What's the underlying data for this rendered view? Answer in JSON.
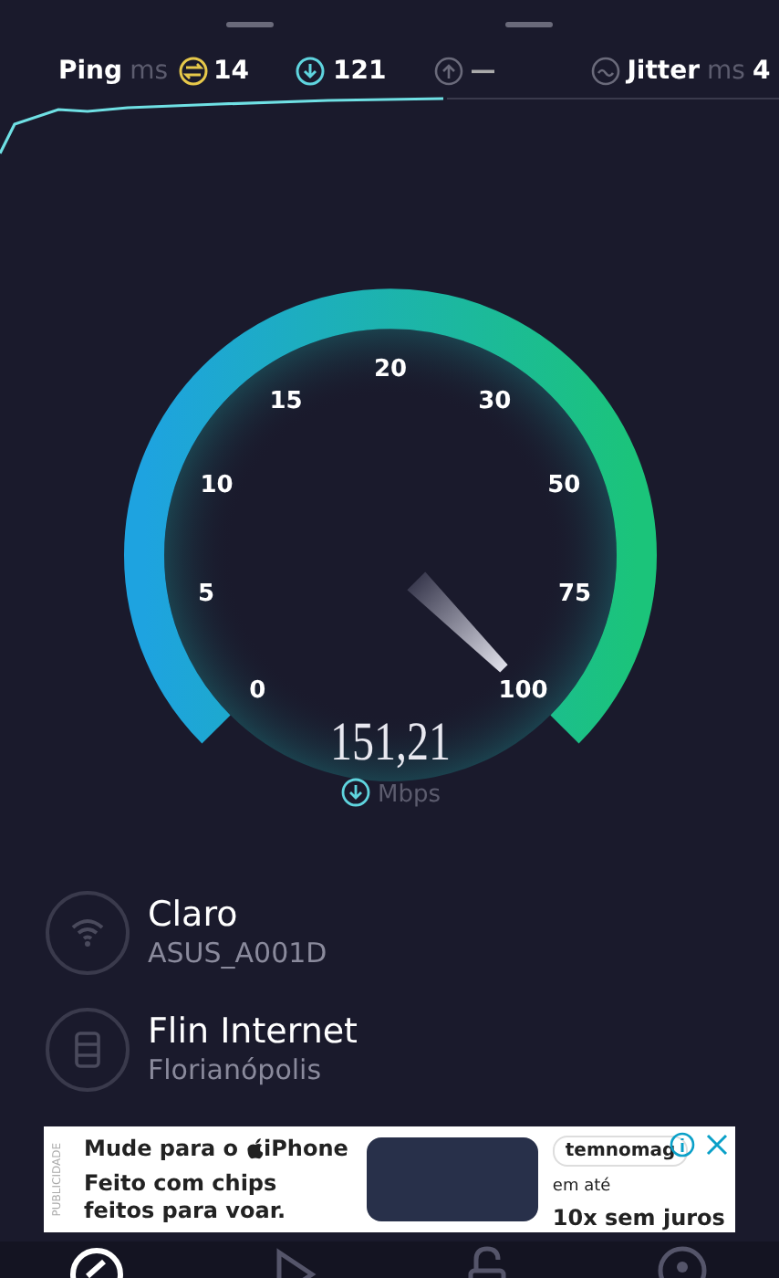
{
  "stats": {
    "ping_label": "Ping",
    "ping_unit": "ms",
    "ping_value": "14",
    "download_value": "121",
    "upload_value": "—",
    "jitter_label": "Jitter",
    "jitter_unit": "ms",
    "jitter_value": "4"
  },
  "gauge": {
    "scale_labels": [
      "0",
      "5",
      "10",
      "15",
      "20",
      "30",
      "50",
      "75",
      "100"
    ],
    "value": "151,21",
    "unit": "Mbps"
  },
  "connections": [
    {
      "kind": "wifi",
      "name": "Claro",
      "detail": "ASUS_A001D"
    },
    {
      "kind": "server",
      "name": "Flin Internet",
      "detail": "Florianópolis"
    }
  ],
  "ad": {
    "side_label": "PUBLICIDADE",
    "headline_prefix": "Mude para o",
    "headline_product": "iPhone",
    "body": "Feito com chips feitos para voar.",
    "store_logo": "temnomag",
    "offer_prefix": "em até",
    "offer": "10x sem juros"
  },
  "nav": [
    {
      "kind": "speed",
      "selected": true
    },
    {
      "kind": "play",
      "selected": false
    },
    {
      "kind": "lock",
      "selected": false
    },
    {
      "kind": "pin",
      "selected": false
    }
  ]
}
